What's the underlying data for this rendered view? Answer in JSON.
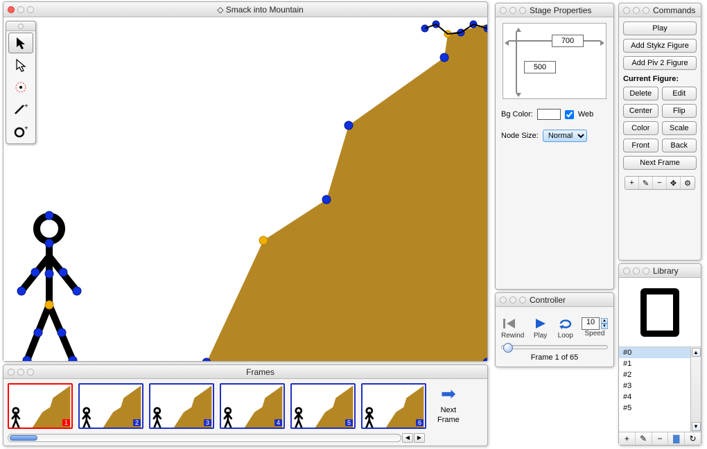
{
  "app": {
    "title": "Smack into Mountain"
  },
  "tools": [
    {
      "name": "select-solid-icon",
      "label": "▲"
    },
    {
      "name": "select-outline-icon",
      "label": "△"
    },
    {
      "name": "target-icon",
      "label": "target"
    },
    {
      "name": "add-line-icon",
      "label": "line"
    },
    {
      "name": "add-circle-icon",
      "label": "circle"
    }
  ],
  "frames": {
    "panel_title": "Frames",
    "next_label_1": "Next",
    "next_label_2": "Frame",
    "items": [
      {
        "n": "1",
        "selected": true
      },
      {
        "n": "2",
        "selected": false
      },
      {
        "n": "3",
        "selected": false
      },
      {
        "n": "4",
        "selected": false
      },
      {
        "n": "5",
        "selected": false
      },
      {
        "n": "6",
        "selected": false
      }
    ]
  },
  "stage_props": {
    "panel_title": "Stage Properties",
    "width": "700",
    "height": "500",
    "bg_label": "Bg Color:",
    "web_label": "Web",
    "web_checked": true,
    "node_label": "Node Size:",
    "node_value": "Normal"
  },
  "controller": {
    "panel_title": "Controller",
    "rewind": "Rewind",
    "play": "Play",
    "loop": "Loop",
    "speed": "Speed",
    "speed_value": "10",
    "frame_status": "Frame 1 of 65"
  },
  "commands": {
    "panel_title": "Commands",
    "play": "Play",
    "add_stykz": "Add Stykz Figure",
    "add_piv": "Add Piv 2 Figure",
    "current_figure_label": "Current Figure:",
    "delete": "Delete",
    "edit": "Edit",
    "center": "Center",
    "flip": "Flip",
    "color": "Color",
    "scale": "Scale",
    "front": "Front",
    "back": "Back",
    "next_frame": "Next Frame"
  },
  "library": {
    "panel_title": "Library",
    "items": [
      "#0",
      "#1",
      "#2",
      "#3",
      "#4",
      "#5"
    ],
    "selected": 0
  }
}
